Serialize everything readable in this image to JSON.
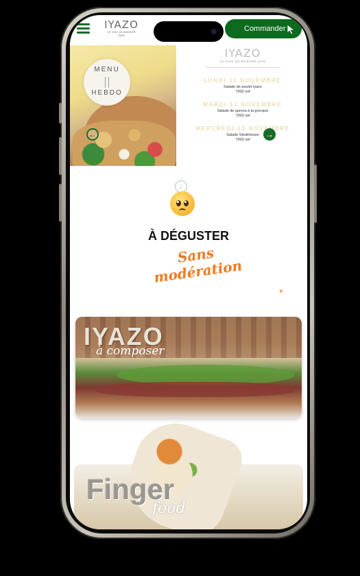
{
  "header": {
    "logo_text": "IYAZO",
    "logo_tagline": "LE CHIC DE MANGER SAIN",
    "order_button": "Commander"
  },
  "menu_hebdo": {
    "badge_top": "MENU",
    "badge_bottom": "HEBDO",
    "logo_text": "IYAZO",
    "logo_tagline": "LE CHIC DE MANGER SAIN",
    "days": [
      {
        "day": "LUNDI 11 NOVEMBRE",
        "dish": "Salade de poulet Iyazo",
        "price": "7000 xof"
      },
      {
        "day": "MARDI 12 NOVEMBRE",
        "dish": "Salade de quinoa à la grecque",
        "price": "7000 xof"
      },
      {
        "day": "MERCREDI 13 NOVEMBRE",
        "dish": "Salade Steakhouse",
        "price": "7000 xof"
      }
    ]
  },
  "tasting": {
    "title": "À DÉGUSTER",
    "subtitle": "Sans modération",
    "plus_symbol": "+"
  },
  "cards": [
    {
      "title": "IYAZO",
      "subtitle": "à composer"
    },
    {
      "title": "Finger",
      "subtitle": "food"
    }
  ],
  "colors": {
    "brand_green": "#0c6b1f",
    "accent_orange": "#ef7a20",
    "gold": "#e2cf8c"
  },
  "icons": {
    "menu": "hamburger-icon",
    "cursor": "pointer-cursor-icon",
    "prev": "arrow-left-icon",
    "next": "arrow-right-icon",
    "down": "arrow-down-icon",
    "emoji": "pleading-face-icon"
  }
}
